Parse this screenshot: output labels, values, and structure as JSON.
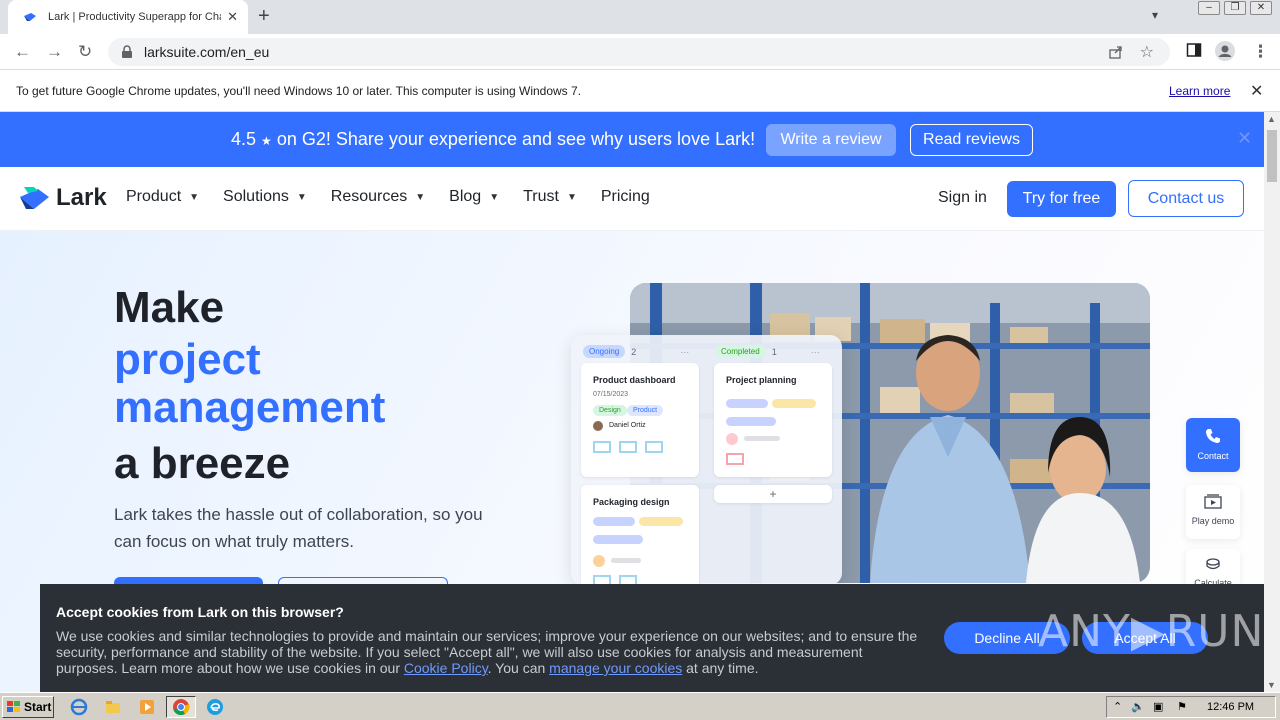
{
  "browser": {
    "tab_title": "Lark | Productivity Superapp for Cha",
    "url": "larksuite.com/en_eu",
    "update_message": "To get future Google Chrome updates, you'll need Windows 10 or later. This computer is using Windows 7.",
    "learn_more": "Learn more"
  },
  "banner": {
    "rating": "4.5",
    "star": "★",
    "text": "on G2! Share your experience and see why users love Lark!",
    "write_review": "Write a review",
    "read_reviews": "Read reviews"
  },
  "nav": {
    "logo": "Lark",
    "items": [
      "Product",
      "Solutions",
      "Resources",
      "Blog",
      "Trust",
      "Pricing"
    ],
    "sign_in": "Sign in",
    "try_free": "Try for free",
    "contact_us": "Contact us"
  },
  "hero": {
    "line1": "Make",
    "line2": "project",
    "line3": "management",
    "line4": "a breeze",
    "subtitle": "Lark takes the hassle out of collaboration, so you can focus on what truly matters."
  },
  "board": {
    "col1_status": "Ongoing",
    "col1_count": "2",
    "col2_status": "Completed",
    "col2_count": "1",
    "card1_title": "Product dashboard",
    "card1_date": "07/15/2023",
    "card1_tag1": "Design",
    "card1_tag2": "Product",
    "card1_user": "Daniel Ortiz",
    "card2_title": "Packaging design",
    "card3_title": "Project planning",
    "add": "+"
  },
  "side": {
    "contact": "Contact",
    "play_demo": "Play demo",
    "calculate": "Calculate costs"
  },
  "cookie": {
    "title": "Accept cookies from Lark on this browser?",
    "body1": "We use cookies and similar technologies to provide and maintain our services; improve your experience on our websites; and to ensure the security, performance and stability of the website. If you select \"Accept all\", we will also use cookies for analysis and measurement purposes. Learn more about how we use cookies in our ",
    "policy_link": "Cookie Policy",
    "body2": ". You can ",
    "manage_link": "manage your cookies",
    "body3": " at any time.",
    "decline": "Decline All",
    "accept": "Accept All",
    "watermark": "ANY▶RUN"
  },
  "taskbar": {
    "start": "Start",
    "clock": "12:46 PM"
  },
  "colors": {
    "brand_blue": "#3370ff",
    "cookie_bg": "#2b2f36",
    "text_dark": "#1f2329"
  }
}
